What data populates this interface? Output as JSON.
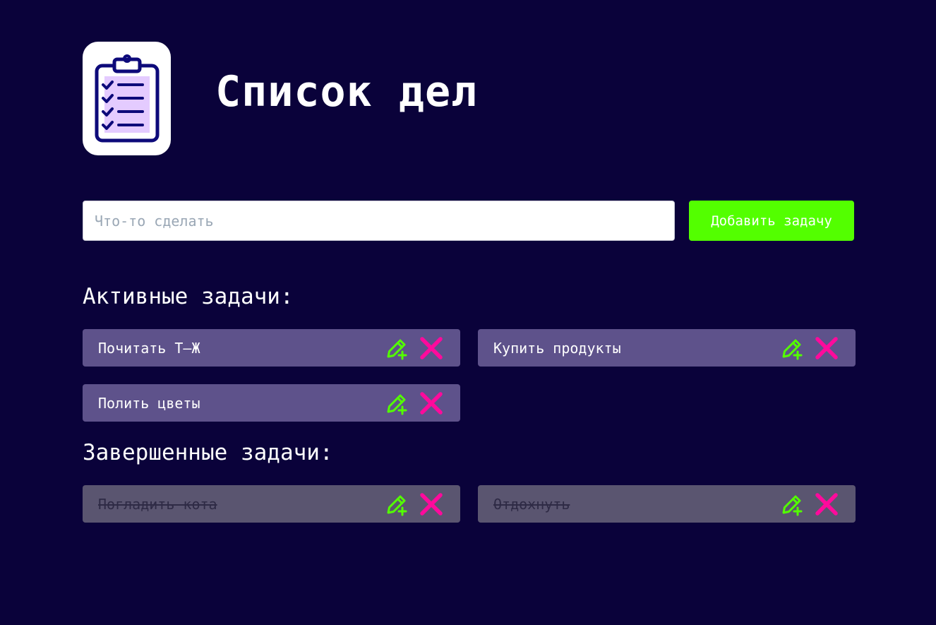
{
  "header": {
    "logo_icon": "clipboard-checklist-icon",
    "title": "Список дел"
  },
  "add_form": {
    "placeholder": "Что-то сделать",
    "value": "",
    "button_label": "Добавить задачу"
  },
  "active": {
    "heading": "Активные задачи:",
    "tasks": [
      {
        "text": "Почитать Т—Ж"
      },
      {
        "text": "Купить продукты"
      },
      {
        "text": "Полить цветы"
      }
    ]
  },
  "completed": {
    "heading": "Завершенные задачи:",
    "tasks": [
      {
        "text": "Погладить кота"
      },
      {
        "text": "Отдохнуть"
      }
    ]
  },
  "icons": {
    "edit": "pencil-plus-icon",
    "delete": "cross-icon"
  },
  "colors": {
    "background": "#0a023a",
    "accent_green": "#53ff00",
    "delete_pink": "#ff0a9c",
    "card_active": "#5e528b",
    "card_done": "#5a5570"
  }
}
